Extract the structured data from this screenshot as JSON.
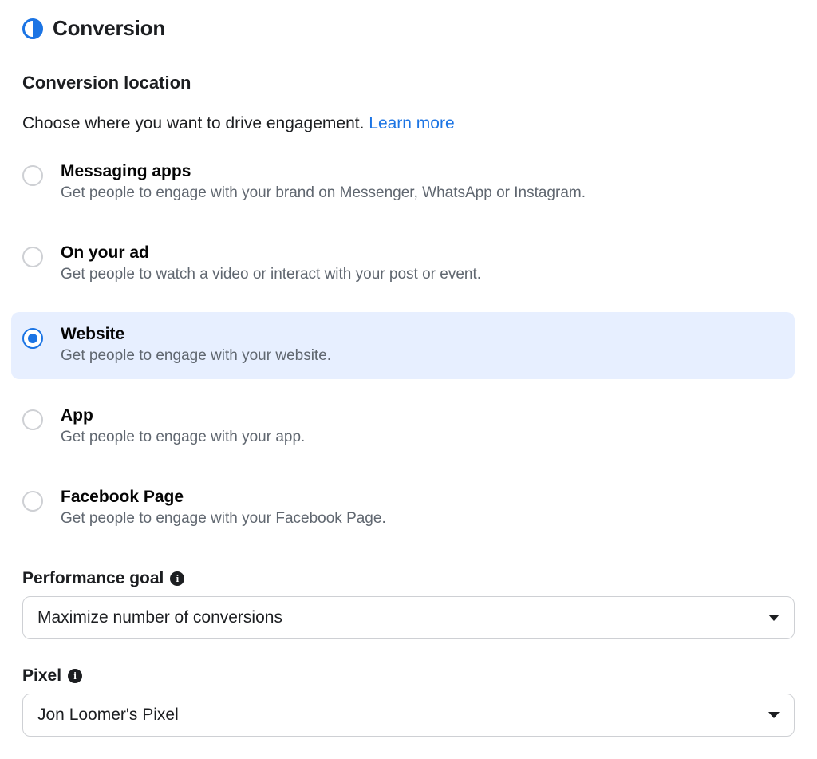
{
  "header": {
    "title": "Conversion"
  },
  "conversion_location": {
    "section_title": "Conversion location",
    "description": "Choose where you want to drive engagement. ",
    "learn_more": "Learn more",
    "options": [
      {
        "title": "Messaging apps",
        "sub": "Get people to engage with your brand on Messenger, WhatsApp or Instagram.",
        "selected": false
      },
      {
        "title": "On your ad",
        "sub": "Get people to watch a video or interact with your post or event.",
        "selected": false
      },
      {
        "title": "Website",
        "sub": "Get people to engage with your website.",
        "selected": true
      },
      {
        "title": "App",
        "sub": "Get people to engage with your app.",
        "selected": false
      },
      {
        "title": "Facebook Page",
        "sub": "Get people to engage with your Facebook Page.",
        "selected": false
      }
    ]
  },
  "performance_goal": {
    "label": "Performance goal",
    "value": "Maximize number of conversions"
  },
  "pixel": {
    "label": "Pixel",
    "value": "Jon Loomer's Pixel"
  }
}
